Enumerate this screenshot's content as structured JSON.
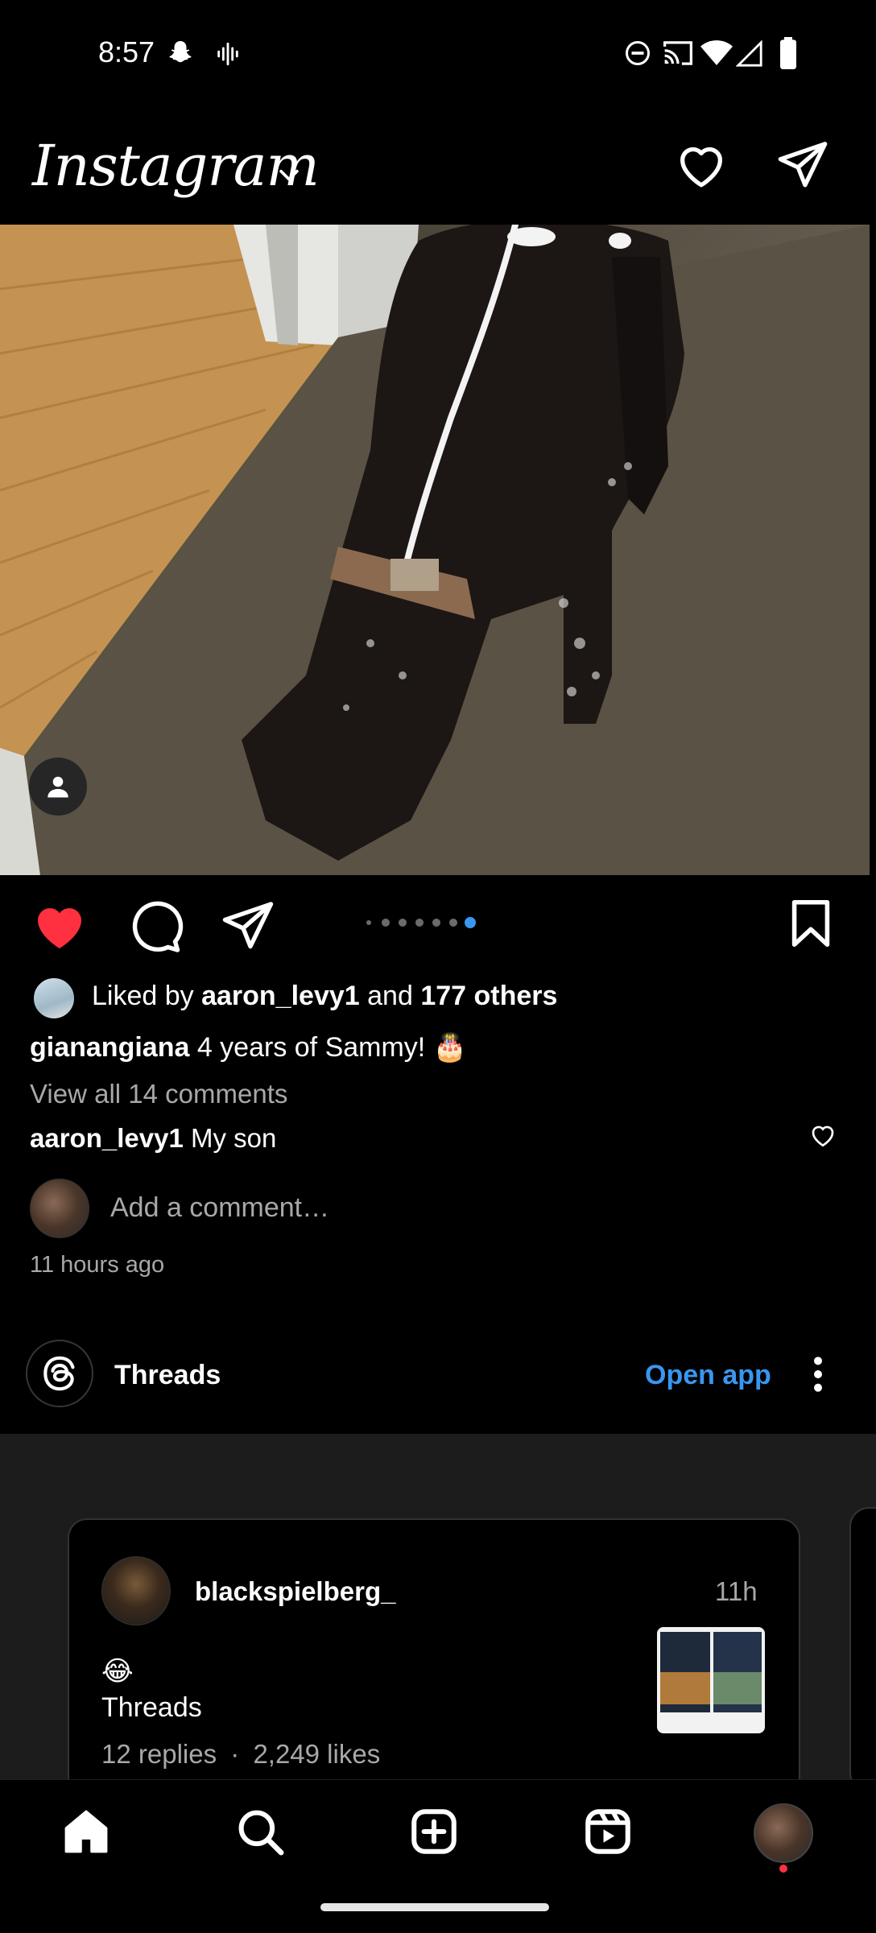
{
  "status_bar": {
    "time": "8:57"
  },
  "header": {
    "title": "Instagram"
  },
  "post": {
    "likes_text_prefix": "Liked by ",
    "liker": "aaron_levy1",
    "likes_text_and": " and ",
    "likes_others": "177 others",
    "author": "gianangiana",
    "caption": "4 years of Sammy! 🎂",
    "view_comments": "View all 14 comments",
    "comment": {
      "user": "aaron_levy1",
      "text": "My son"
    },
    "add_comment_placeholder": "Add a comment…",
    "timestamp": "11 hours ago",
    "carousel": {
      "count": 7,
      "active_index": 6
    }
  },
  "threads_promo": {
    "title": "Threads",
    "open_app_label": "Open app",
    "card": {
      "username": "blackspielberg_",
      "time": "11h",
      "emoji": "😂",
      "text": "Threads",
      "replies": "12 replies",
      "separator": "·",
      "likes": "2,249 likes"
    }
  },
  "colors": {
    "accent_blue": "#3897f0",
    "like_red": "#ff3040",
    "muted_text": "#a8a8a8"
  }
}
